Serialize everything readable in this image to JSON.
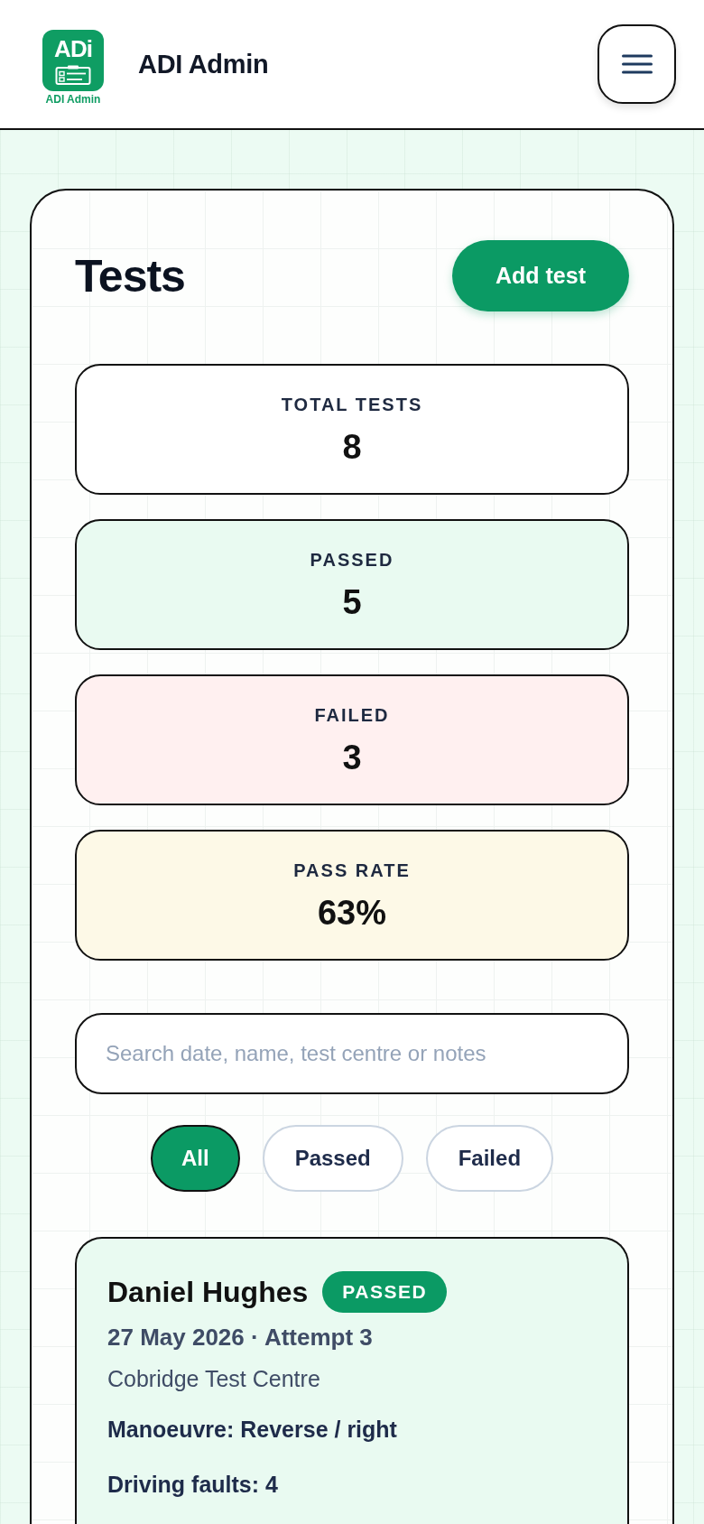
{
  "header": {
    "logo": {
      "mark": "ADi",
      "caption": "ADI Admin"
    },
    "title": "ADI Admin"
  },
  "page": {
    "title": "Tests",
    "add_button": "Add test"
  },
  "stats": [
    {
      "label": "TOTAL TESTS",
      "value": "8",
      "color": "#ffffff"
    },
    {
      "label": "PASSED",
      "value": "5",
      "color": "#e9faf1"
    },
    {
      "label": "FAILED",
      "value": "3",
      "color": "#fff0f0"
    },
    {
      "label": "PASS RATE",
      "value": "63%",
      "color": "#fdf9e7"
    }
  ],
  "search": {
    "placeholder": "Search date, name, test centre or notes"
  },
  "filters": [
    {
      "label": "All",
      "selected": true
    },
    {
      "label": "Passed",
      "selected": false
    },
    {
      "label": "Failed",
      "selected": false
    }
  ],
  "tests": [
    {
      "name": "Daniel Hughes",
      "status": {
        "label": "PASSED",
        "kind": "passed"
      },
      "date_line": "27 May 2026 · Attempt 3",
      "centre": "Cobridge Test Centre",
      "manoeuvre": "Manoeuvre: Reverse / right",
      "faults": "Driving faults: 4"
    }
  ]
}
